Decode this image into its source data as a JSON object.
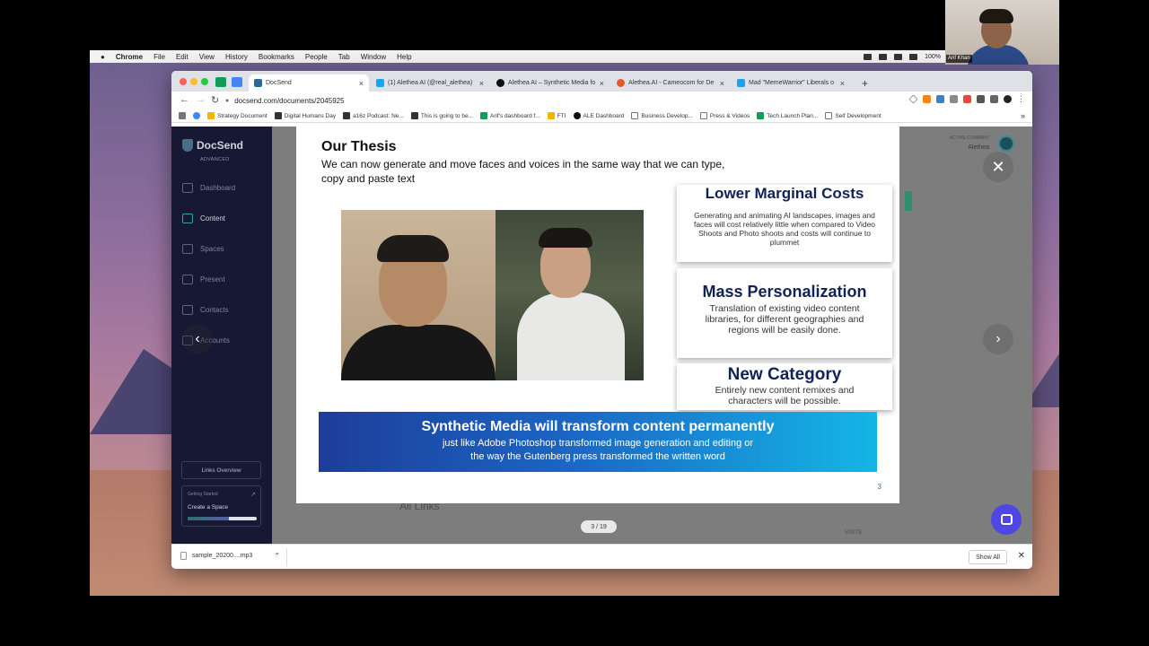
{
  "menubar": {
    "apple": "",
    "app": "Chrome",
    "items": [
      "File",
      "Edit",
      "View",
      "History",
      "Bookmarks",
      "People",
      "Tab",
      "Window",
      "Help"
    ],
    "battery": "100%"
  },
  "webcam": {
    "name": "Arif Khan"
  },
  "tabs": [
    {
      "label": "DocSend",
      "icon_color": "#2b6b9a"
    },
    {
      "label": "(1) Alethea AI (@real_alethea)",
      "icon_color": "#1da1f2"
    },
    {
      "label": "Alethea AI – Synthetic Media fo",
      "icon_color": "#111111"
    },
    {
      "label": "Alethea.AI - Cameocom for De",
      "icon_color": "#e05a2b"
    },
    {
      "label": "Mad \"MemeWarrior\" Liberals o",
      "icon_color": "#1da1f2"
    }
  ],
  "new_tab": "+",
  "url": "docsend.com/documents/2045925",
  "bookmarks": [
    {
      "label": "Strategy Document",
      "color": "#f4b400"
    },
    {
      "label": "Digital Humans Day",
      "color": "#333333"
    },
    {
      "label": "a16z Podcast: Ne...",
      "color": "#333333"
    },
    {
      "label": "This is going to be...",
      "color": "#333333"
    },
    {
      "label": "Arif's dashboard f...",
      "color": "#0f9d58"
    },
    {
      "label": "FTI",
      "color": "#f4b400"
    },
    {
      "label": "ALE Dashboard",
      "color": "#111111"
    },
    {
      "label": "Business Develop...",
      "color": "#777777"
    },
    {
      "label": "Press & Videos",
      "color": "#777777"
    },
    {
      "label": "Tech Launch Plan...",
      "color": "#0f9d58"
    },
    {
      "label": "Self Development",
      "color": "#777777"
    }
  ],
  "bookmarks_more": "»",
  "sidebar": {
    "brand": "DocSend",
    "tier": "ADVANCED",
    "items": [
      "Dashboard",
      "Content",
      "Spaces",
      "Present",
      "Contacts",
      "Accounts"
    ],
    "active": "Content",
    "links_overview": "Links Overview",
    "getting_started": "Getting Started",
    "create_space": "Create a Space",
    "create_space_progress": 0.6
  },
  "background": {
    "active_company_label": "ACTIVE COMPANY",
    "active_company": "Alethea",
    "all_links": "All Links",
    "visits": "VISITS"
  },
  "slide": {
    "title": "Our Thesis",
    "subtitle": "We can now generate and move faces and voices in the same way that we can type, copy and paste text",
    "cards": [
      {
        "heading": "Lower Marginal Costs",
        "text": "Generating and animating AI landscapes, images and faces  will cost relatively little  when compared to Video Shoots and Photo shoots and costs will continue to plummet"
      },
      {
        "heading": "Mass Personalization",
        "text": "Translation of existing video content libraries, for different geographies and regions will be easily done."
      },
      {
        "heading": "New Category",
        "text": "Entirely new content remixes and characters will be possible."
      }
    ],
    "banner_heading": "Synthetic Media will transform content permanently",
    "banner_line1": "just like Adobe Photoshop transformed image generation and editing or",
    "banner_line2": "the way the Gutenberg press transformed the written word",
    "page_number": "3"
  },
  "viewer": {
    "pager": "3 / 19",
    "close": "✕",
    "next": "›",
    "prev": "‹"
  },
  "download": {
    "file": "sample_20200....mp3",
    "show_all": "Show All",
    "close": "✕"
  }
}
